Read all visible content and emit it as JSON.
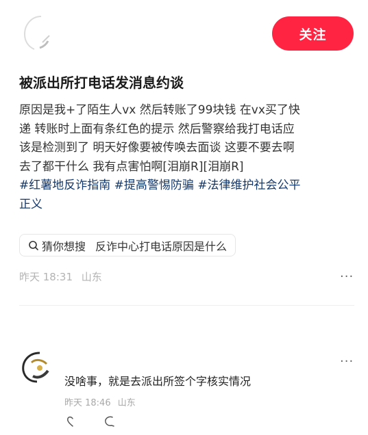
{
  "header": {
    "follow_label": "关注"
  },
  "post": {
    "title": "被派出所打电话发消息约谈",
    "body_lines": [
      "原因是我+了陌生人vx 然后转账了99块钱 在vx买了快",
      "递 转账时上面有条红色的提示 然后警察给我打电话应",
      "该是检测到了 明天好像要被传唤去面谈 这要不要去啊",
      "去了都干什么 我有点害怕啊[泪崩R][泪崩R]"
    ],
    "tags": [
      "#红薯地反诈指南",
      "#提高警惕防骗",
      "#法律维护社会公平",
      "正义"
    ],
    "search_chip": {
      "label": "猜你想搜",
      "query": "反诈中心打电话原因是什么"
    },
    "time": "昨天 18:31",
    "location": "山东"
  },
  "comment": {
    "text": "没啥事，就是去派出所签个字核实情况",
    "time": "昨天 18:46",
    "location": "山东"
  },
  "more_label": "···",
  "icons": {
    "search": "search-icon",
    "like": "heart-icon",
    "reply": "reply-icon",
    "more": "more-dots-icon"
  },
  "colors": {
    "accent": "#ff2442",
    "tag": "#13386c",
    "meta": "#b3b3b3"
  }
}
